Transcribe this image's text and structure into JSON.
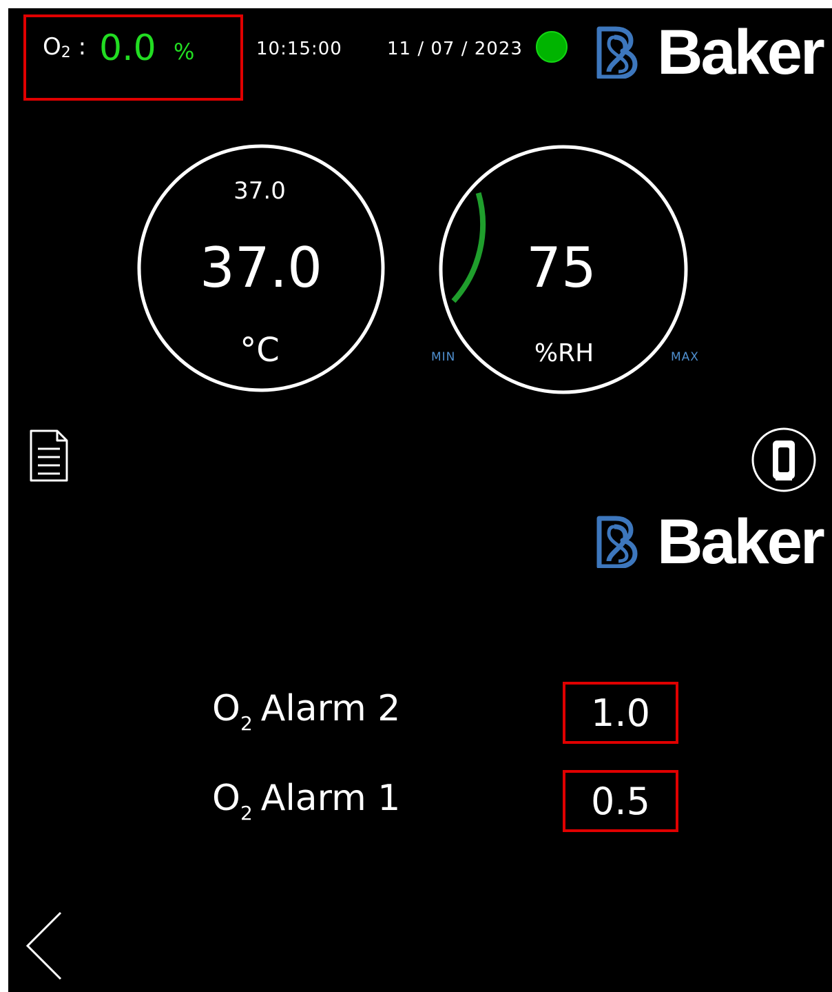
{
  "header": {
    "o2_label": "O",
    "o2_sub": "2",
    "o2_separator": ":",
    "o2_value": "0.0",
    "o2_unit": "%",
    "time": "10:15:00",
    "date": "11 / 07 / 2023",
    "status_color": "#00b400",
    "logo_text": "Baker"
  },
  "temperature": {
    "setpoint": "37.0",
    "value": "37.0",
    "unit": "°C"
  },
  "humidity": {
    "value": "75",
    "unit": "%RH",
    "min_label": "MIN",
    "max_label": "MAX",
    "gauge_color": "#1f9e2c"
  },
  "middle": {
    "logo_text": "Baker",
    "document_icon": "document-icon",
    "door_icon": "door-icon"
  },
  "alarms": [
    {
      "label": "O",
      "sub": "2",
      "name": "Alarm 2",
      "value": "1.0"
    },
    {
      "label": "O",
      "sub": "2",
      "name": "Alarm 1",
      "value": "0.5"
    }
  ],
  "footer": {
    "back_icon": "chevron-left-icon"
  },
  "colors": {
    "background": "#000000",
    "highlight_border": "#e00000",
    "o2_value": "#22dd22",
    "logo_blue": "#3d77bd",
    "min_max_text": "#4f8fcf"
  }
}
